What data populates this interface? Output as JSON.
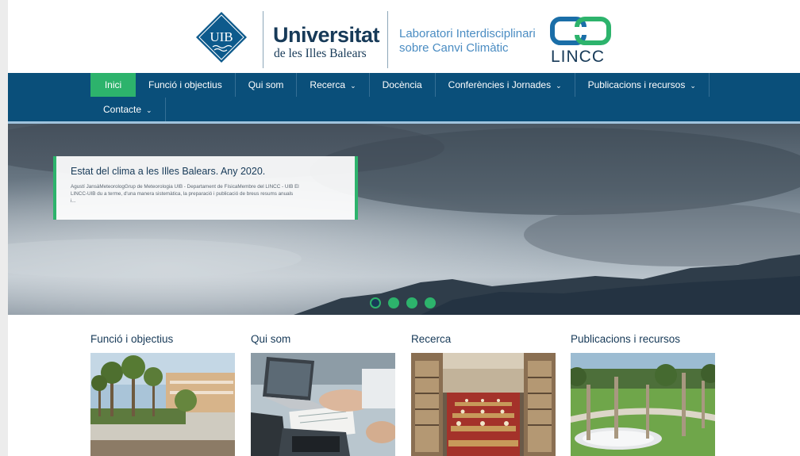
{
  "header": {
    "uib_logo_text": "UIB",
    "university_name": "Universitat",
    "university_sub": "de les Illes Balears",
    "lab_line1": "Laboratori Interdisciplinari",
    "lab_line2": "sobre Canvi Climàtic",
    "lincc_text": "LINCC"
  },
  "nav": {
    "items": [
      {
        "label": "Inici",
        "active": true
      },
      {
        "label": "Funció i objectius"
      },
      {
        "label": "Qui som"
      },
      {
        "label": "Recerca",
        "dropdown": true
      },
      {
        "label": "Docència"
      },
      {
        "label": "Conferències i Jornades",
        "dropdown": true
      },
      {
        "label": "Publicacions i recursos",
        "dropdown": true
      },
      {
        "label": "Contacte",
        "dropdown": true
      }
    ],
    "chevron": "⌄"
  },
  "hero": {
    "caption_title": "Estat del clima a les Illes Balears. Any 2020.",
    "caption_body_line1": "Agustí JansàMeteorologGrup de Meteorologia UIB - Departament de FísicaMembre del LINCC - UIB El",
    "caption_body_line2": "LINCC-UIB du a terme, d'una manera sistemàtica, la preparació i publicació de breus resums anuals",
    "caption_body_line3": "i...",
    "slides": 4,
    "active_slide": 0
  },
  "cards": [
    {
      "title": "Funció i objectius",
      "image": "campus-palm-trees-photo"
    },
    {
      "title": "Qui som",
      "image": "laptop-desk-photo"
    },
    {
      "title": "Recerca",
      "image": "library-photo"
    },
    {
      "title": "Publicacions i recursos",
      "image": "sundial-park-photo"
    }
  ],
  "colors": {
    "navy": "#0a4f7a",
    "accent_green": "#2db36c",
    "brand_dark": "#173a58",
    "brand_light_blue": "#4a8cc2"
  }
}
